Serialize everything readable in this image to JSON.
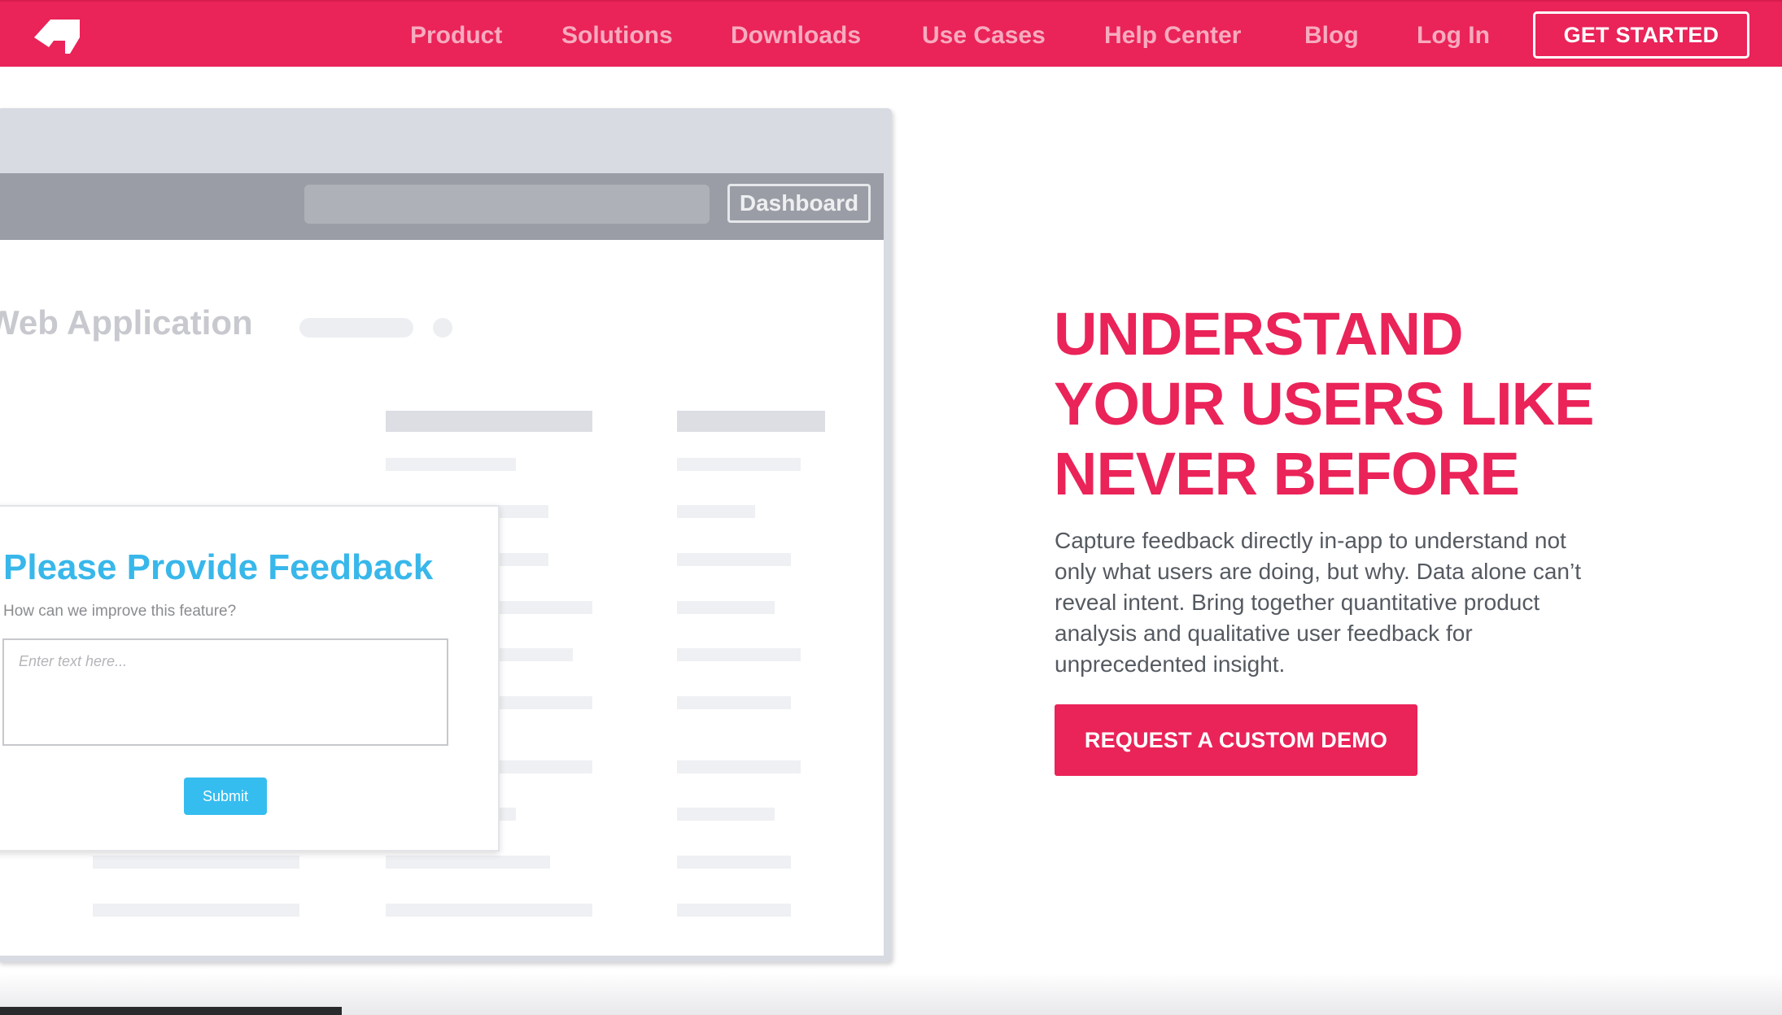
{
  "brand": {
    "accent_color": "#ea2358",
    "logo_icon": "arrow-flag-logo-icon"
  },
  "nav": {
    "links": [
      "Product",
      "Solutions",
      "Downloads",
      "Use Cases",
      "Help Center",
      "Blog",
      "Log In"
    ],
    "cta_label": "GET STARTED"
  },
  "mock_app": {
    "dashboard_label": "Dashboard",
    "page_title": "Web Application",
    "feedback_modal": {
      "title": "Please Provide Feedback",
      "subtitle": "How can we improve this feature?",
      "placeholder": "Enter text here...",
      "submit_label": "Submit",
      "title_color": "#38b7ea"
    }
  },
  "hero": {
    "title_lines": [
      "UNDERSTAND",
      "YOUR USERS LIKE",
      "NEVER BEFORE"
    ],
    "description": "Capture feedback directly in-app to understand not only what users are doing, but why. Data alone can’t reveal intent. Bring together quantitative product analysis and qualitative user feedback for unprecedented insight.",
    "cta_label": "REQUEST A CUSTOM DEMO"
  }
}
